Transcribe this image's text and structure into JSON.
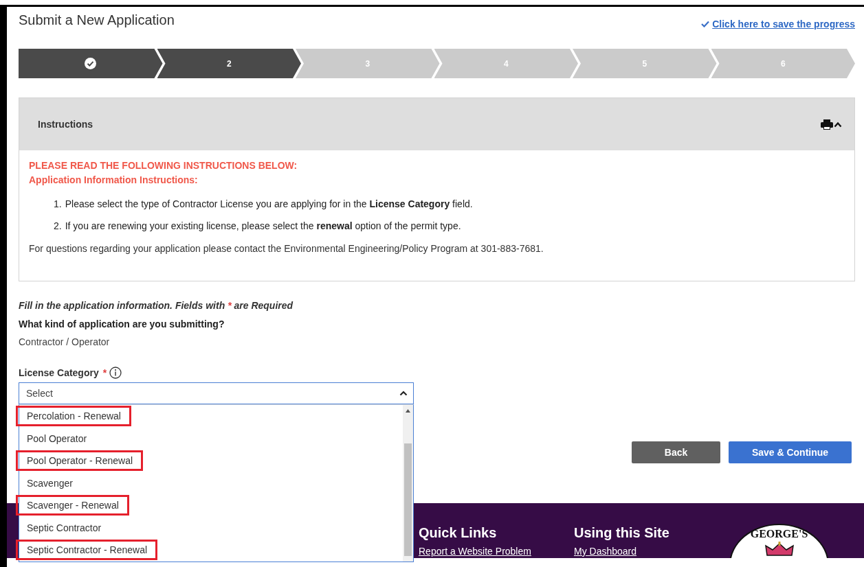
{
  "page": {
    "title": "Submit a New Application",
    "save_link": "Click here to save the progress"
  },
  "steps": [
    {
      "kind": "done"
    },
    {
      "label": "2",
      "kind": "current"
    },
    {
      "label": "3",
      "kind": "todo"
    },
    {
      "label": "4",
      "kind": "todo"
    },
    {
      "label": "5",
      "kind": "todo"
    },
    {
      "label": "6",
      "kind": "todo"
    }
  ],
  "instructions": {
    "title": "Instructions",
    "expanded": true,
    "heading": "PLEASE READ THE FOLLOWING INSTRUCTIONS BELOW:",
    "subheading": "Application Information Instructions:",
    "items": [
      {
        "number": "1.",
        "text": "Please select the type of Contractor License you are applying for in the **License Category** field."
      },
      {
        "number": "2.",
        "text": "If you are renewing your existing license, please select the **renewal** option of the permit type."
      }
    ],
    "contact": "For questions regarding your application please contact the Environmental Engineering/Policy Program at 301-883-7681."
  },
  "form": {
    "note_text": "Fill in the application information. Fields with",
    "required_mark": "*",
    "note_end": "are Required",
    "question": "What kind of application are you submitting?",
    "answer": "Contractor / Operator",
    "license_category": {
      "label": "License Category",
      "required_mark": "*",
      "placeholder": "Select",
      "open": true,
      "options": [
        {
          "label": "Percolation - Renewal",
          "highlighted": true
        },
        {
          "label": "Pool Operator",
          "highlighted": false
        },
        {
          "label": "Pool Operator - Renewal",
          "highlighted": true
        },
        {
          "label": "Scavenger",
          "highlighted": false
        },
        {
          "label": "Scavenger - Renewal",
          "highlighted": true
        },
        {
          "label": "Septic Contractor",
          "highlighted": false
        },
        {
          "label": "Septic Contractor - Renewal",
          "highlighted": true
        }
      ]
    }
  },
  "buttons": {
    "back": "Back",
    "save": "Save & Continue"
  },
  "footer": {
    "columns": [
      {
        "heading": "Quick Links",
        "links": [
          "Report a Website Problem"
        ]
      },
      {
        "heading": "Using this Site",
        "links": [
          "My Dashboard"
        ]
      }
    ],
    "logo_text": "GEORGE'S"
  }
}
